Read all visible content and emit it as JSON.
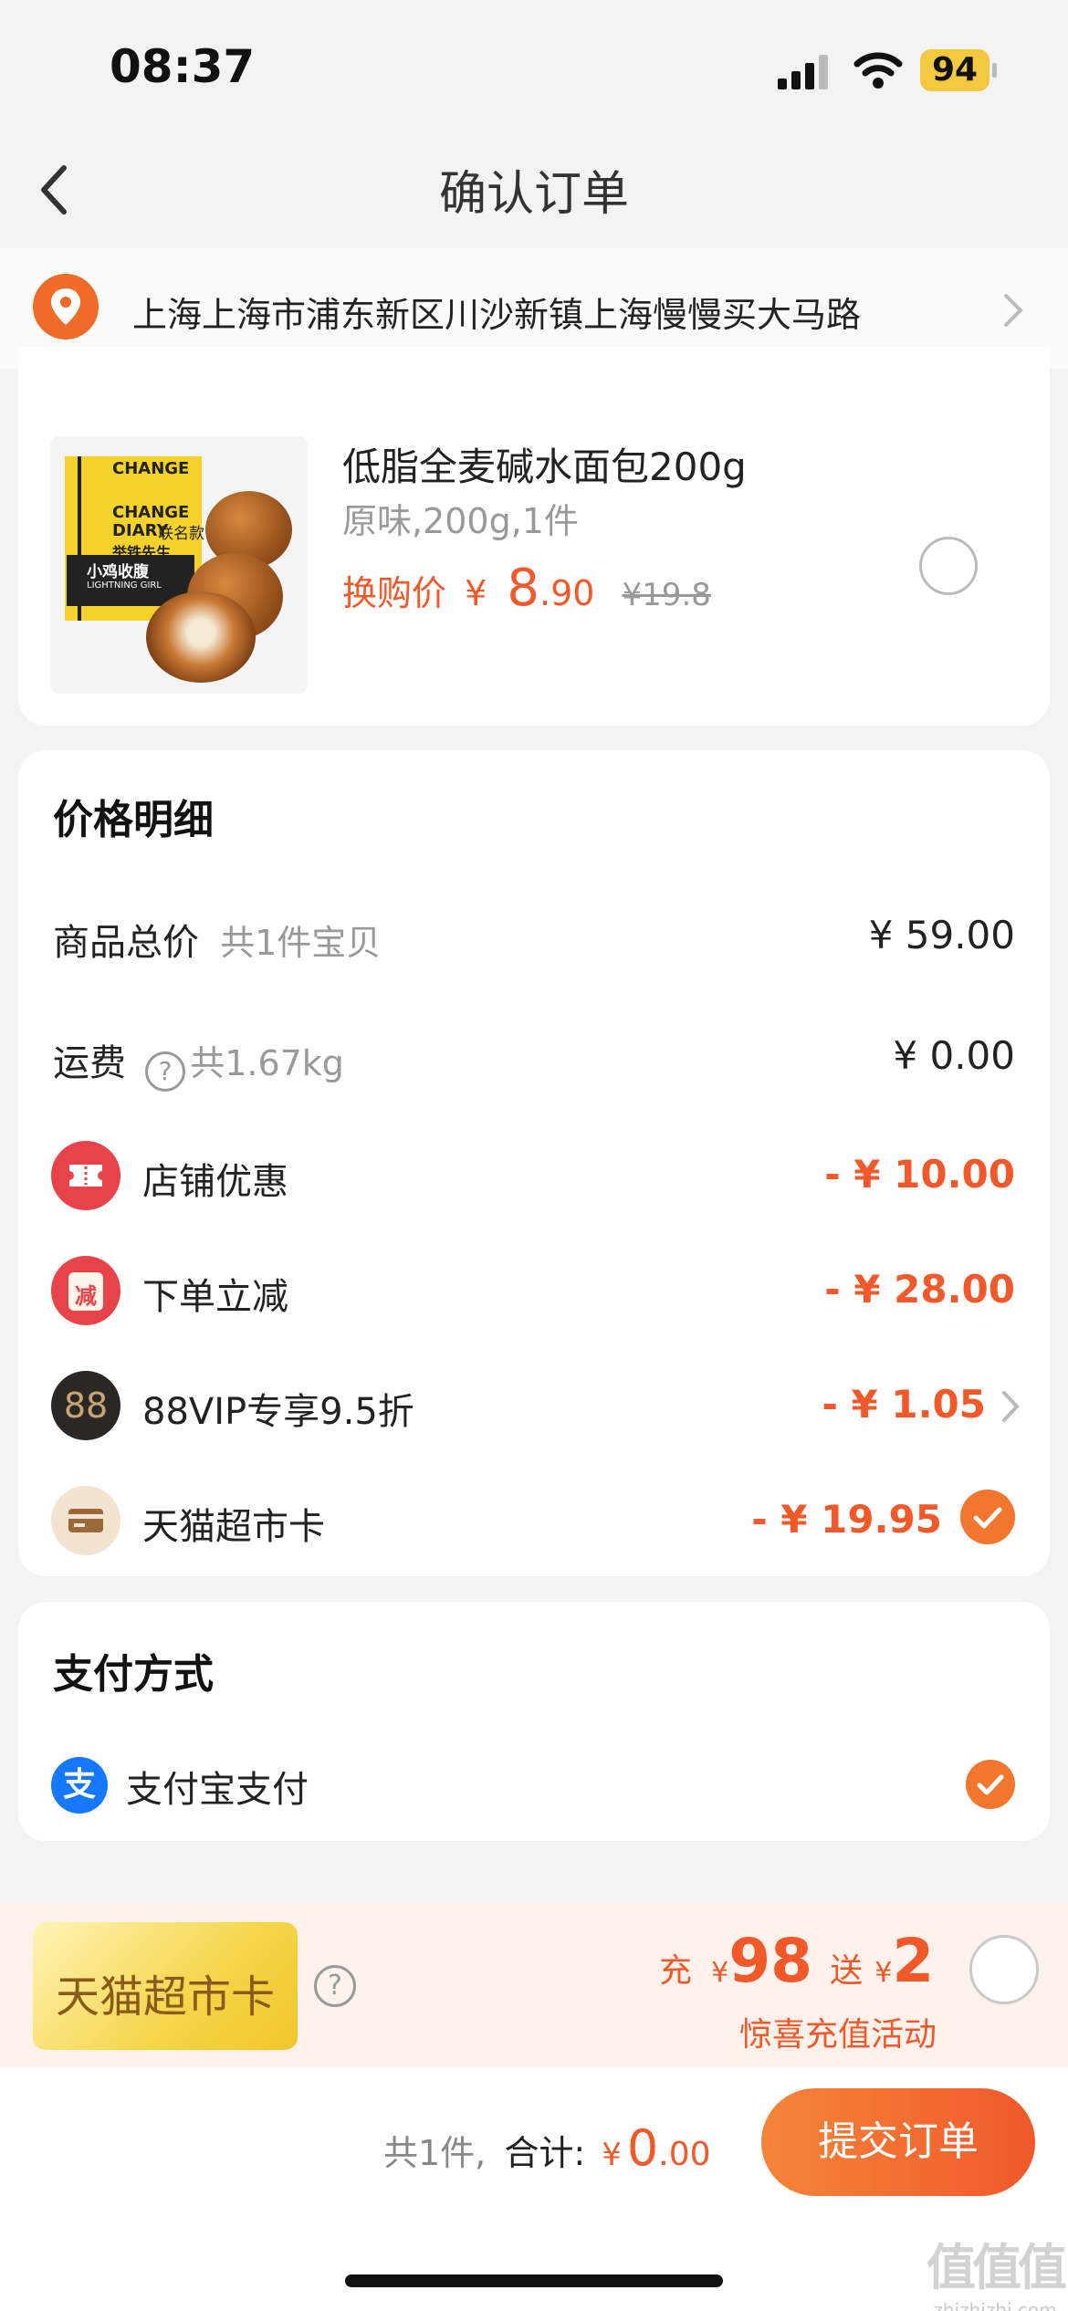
{
  "status": {
    "time": "08:37",
    "battery": "94"
  },
  "nav": {
    "title": "确认订单"
  },
  "address": {
    "text": "上海上海市浦东新区川沙新镇上海慢慢买大马路"
  },
  "product": {
    "title": "低脂全麦碱水面包200g",
    "spec": "原味,200g,1件",
    "price_label": "换购价",
    "currency": "¥",
    "price_int": "8",
    "price_dec": ".90",
    "orig_price": "¥19.8",
    "image_text": [
      "CHANGE",
      "DIARY",
      "联名款",
      "举铁先生",
      "小鸡收腹",
      "LIGHTNING GIRL"
    ]
  },
  "price_detail": {
    "title": "价格明细",
    "rows": [
      {
        "label": "商品总价",
        "sub": "共1件宝贝",
        "value": "¥ 59.00"
      },
      {
        "label": "运费",
        "sub": "共1.67kg",
        "value": "¥ 0.00"
      },
      {
        "label": "店铺优惠",
        "value": "- ¥ 10.00"
      },
      {
        "label": "下单立减",
        "value": "- ¥ 28.00",
        "icon_text": "减"
      },
      {
        "label": "88VIP专享9.5折",
        "value": "- ¥ 1.05",
        "icon_text": "88"
      },
      {
        "label": "天猫超市卡",
        "value": "- ¥ 19.95"
      }
    ]
  },
  "payment": {
    "title": "支付方式",
    "method": "支付宝支付",
    "icon_text": "支"
  },
  "promo": {
    "card_text": "天猫超市卡",
    "charge": "充",
    "charge_amount": "98",
    "gift": "送",
    "gift_amount": "2",
    "currency": "¥",
    "subtitle": "惊喜充值活动"
  },
  "footer": {
    "count_text": "共1件,",
    "total_label": "合计:",
    "currency": "¥",
    "total_int": "0",
    "total_dec": ".00",
    "submit_label": "提交订单"
  },
  "watermark": {
    "glyphs": "值值值",
    "url": "zhizhizhi.com"
  },
  "colors": {
    "accent": "#f2592a",
    "vip_gold": "#c9a574"
  },
  "icons": [
    "back-arrow-icon",
    "location-pin-icon",
    "chevron-right-icon",
    "question-icon",
    "ticket-icon",
    "check-icon",
    "card-icon",
    "alipay-icon"
  ]
}
